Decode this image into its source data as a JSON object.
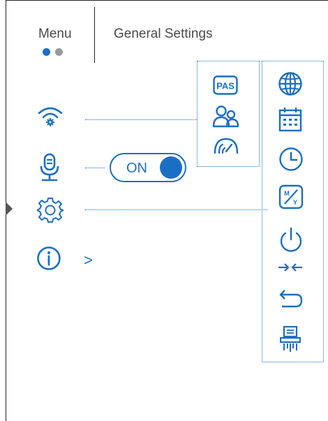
{
  "header": {
    "menu_tab": "Menu",
    "general_tab": "General Settings",
    "page_dots": [
      "active",
      "inactive"
    ]
  },
  "left_menu": [
    {
      "icon": "wifi-settings-icon"
    },
    {
      "icon": "microphone-icon",
      "toggle": "ON"
    },
    {
      "icon": "gear-icon"
    },
    {
      "icon": "info-icon",
      "chevron": ">"
    }
  ],
  "wifi_submenu": {
    "items": [
      {
        "icon": "pas-icon",
        "label": "PAS"
      },
      {
        "icon": "users-icon"
      },
      {
        "icon": "wireless-gauge-icon"
      }
    ]
  },
  "general_submenu": {
    "items": [
      {
        "icon": "globe-icon"
      },
      {
        "icon": "calendar-icon"
      },
      {
        "icon": "clock-icon"
      },
      {
        "icon": "units-icon",
        "label_top": "M",
        "label_bottom": "Y"
      },
      {
        "icon": "power-icon"
      },
      {
        "icon": "arrows-inward-icon"
      },
      {
        "icon": "undo-arrow-icon"
      },
      {
        "icon": "shredder-icon"
      }
    ]
  },
  "colors": {
    "accent": "#1a6fc4",
    "text": "#4a4a4a",
    "inactive_dot": "#9a9a9a"
  }
}
